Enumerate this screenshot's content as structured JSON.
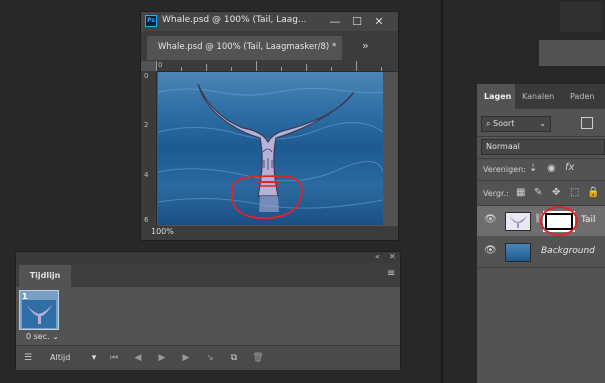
{
  "document": {
    "title": "Whale.psd @ 100% (Tail, Laag...",
    "tab_label": "Whale.psd @ 100% (Tail, Laagmasker/8) *",
    "tab_close": "×",
    "overflow": "»",
    "zoom": "100%",
    "ruler_left": [
      "0",
      "2",
      "4",
      "6"
    ],
    "ruler_top": [
      "0"
    ],
    "app_icon": "Ps"
  },
  "layers_panel": {
    "tabs": [
      "Lagen",
      "Kanalen",
      "Paden"
    ],
    "kind_filter": "Soort",
    "blend_mode": "Normaal",
    "unify_label": "Verenigen:",
    "lock_label": "Vergr.:",
    "layers": [
      {
        "name": "Tail",
        "visible": true
      },
      {
        "name": "Background",
        "visible": true
      }
    ]
  },
  "timeline": {
    "tab_label": "Tijdlijn",
    "frame_number": "1",
    "frame_delay": "0 sec.",
    "loop_option": "Altijd"
  },
  "colors": {
    "accent_annotation": "#e0222a",
    "panel_bg": "#535353",
    "app_bg": "#282828"
  },
  "icons": [
    "photoshop-icon",
    "minimize-icon",
    "maximize-icon",
    "close-icon",
    "search-icon",
    "eye-icon",
    "link-icon",
    "lock-icon",
    "play-icon",
    "trash-icon",
    "new-frame-icon",
    "menu-icon"
  ]
}
